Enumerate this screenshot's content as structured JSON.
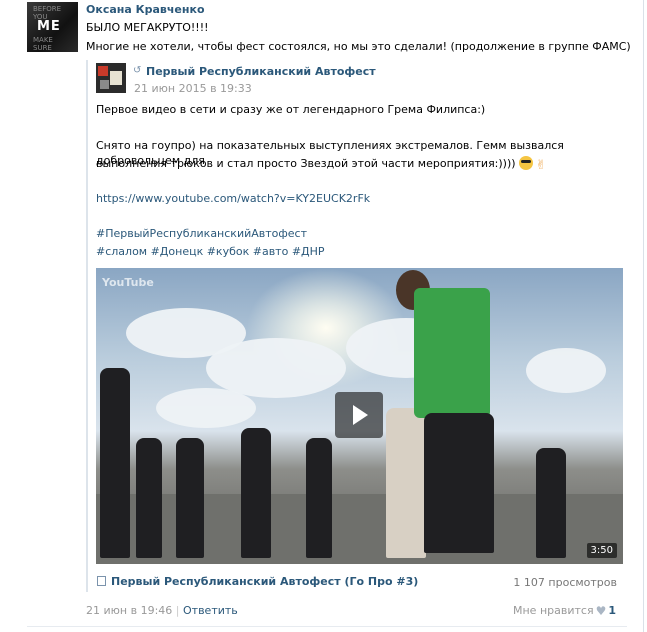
{
  "author": {
    "name": "Оксана Кравченко",
    "avatar_label": "ME"
  },
  "post": {
    "line1": "БЫЛО МЕГАКРУТО!!!!",
    "line2": "Многие не хотели, чтобы фест состоялся, но мы это сделали! (продолжение в группе ФАМС)"
  },
  "repost": {
    "group_name": "Первый Республиканский Автофест",
    "date": "21 июн 2015 в 19:33",
    "text1": "Первое видео в сети и сразу же от легендарного Грема Филипса:)",
    "text2a": "Снято на гоупро) на показательных выступлениях экстремалов. Гемм вызвался добровольцем для",
    "text2b": "выполнения трюков и стал просто Звездой этой части мероприятия:))))",
    "url": "https://www.youtube.com/watch?v=KY2EUCK2rFk",
    "hashtag1": "#ПервыйРеспубликанскийАвтофест",
    "hashtag2": "#слалом #Донецк #кубок #авто #ДНР"
  },
  "video": {
    "watermark": "YouTube",
    "duration": "3:50",
    "title": "Первый Республиканский Автофест (Го Про #3)",
    "views": "1 107 просмотров"
  },
  "footer": {
    "date": "21 июн в 19:46",
    "separator": "|",
    "reply": "Ответить",
    "like_label": "Мне нравится",
    "like_count": "1"
  },
  "colors": {
    "link": "#2b587a",
    "meta": "#999999",
    "accent_green": "#3aa24a"
  },
  "icons": [
    "repost-icon",
    "video-icon",
    "heart-icon",
    "play-icon",
    "sunglasses-emoji",
    "victory-hand-emoji"
  ]
}
